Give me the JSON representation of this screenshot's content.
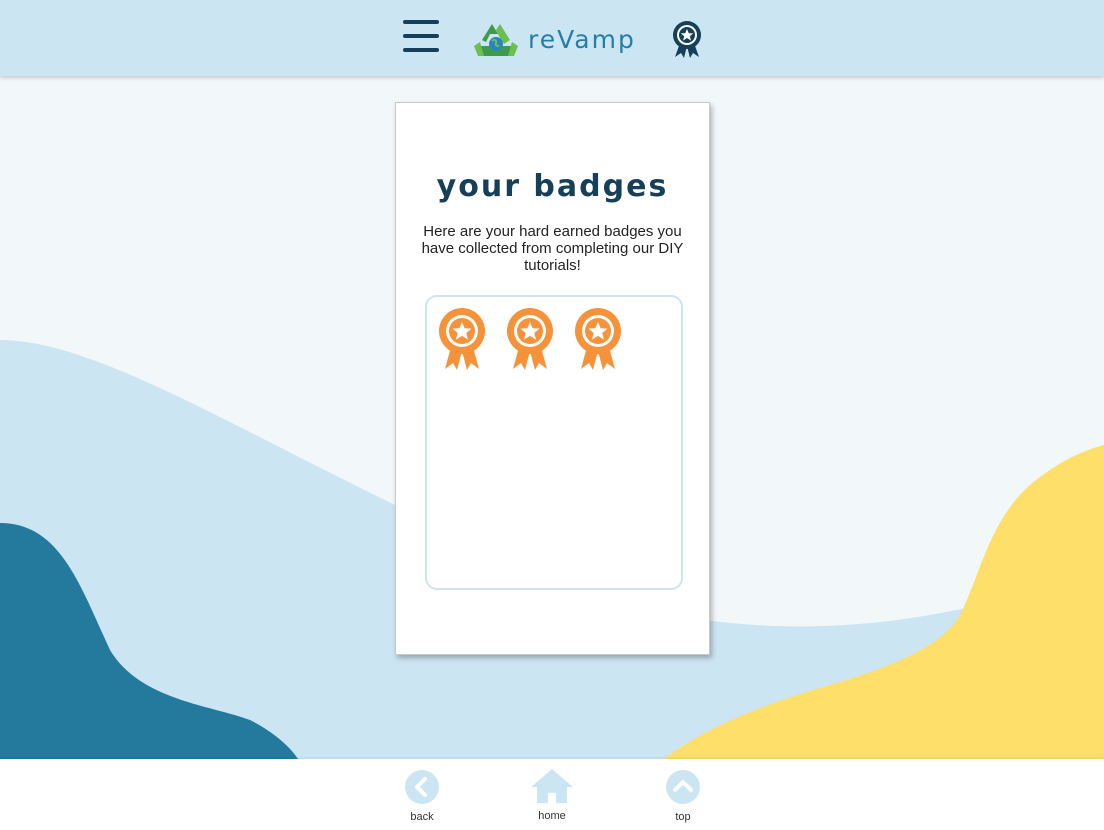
{
  "header": {
    "brand": "reVamp",
    "icons": {
      "menu": "hamburger-menu-icon",
      "logo": "recycle-globe-logo",
      "badge": "award-badge-icon"
    }
  },
  "card": {
    "title": "your badges",
    "description": "Here are your hard earned badges you have collected from completing our DIY tutorials!",
    "badges_count": 3
  },
  "footer": {
    "back_label": "back",
    "home_label": "home",
    "top_label": "top"
  },
  "colors": {
    "header_bg": "#cce5f3",
    "navy": "#16405a",
    "brand_text": "#247fa5",
    "badge_orange": "#f6923a",
    "wave_light_blue": "#cce5f3",
    "wave_dark_blue": "#237a9c",
    "wave_yellow": "#fedf6a"
  }
}
